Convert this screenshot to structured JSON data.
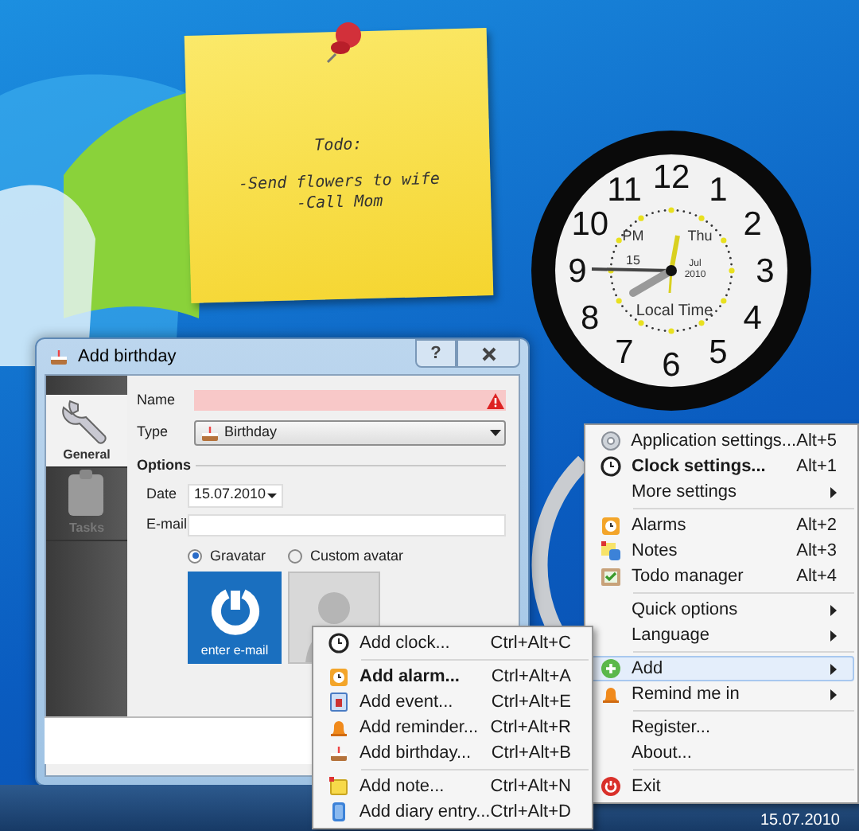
{
  "sticky_note": {
    "lines": [
      "Todo:",
      "-Send flowers to wife",
      "-Call Mom"
    ]
  },
  "clock": {
    "numerals": [
      "12",
      "11",
      "1",
      "10",
      "2",
      "9",
      "3",
      "8",
      "4",
      "7",
      "5",
      "6"
    ],
    "ampm": "PM",
    "weekday": "Thu",
    "day": "15",
    "month": "Jul",
    "year": "2010",
    "caption": "Local Time"
  },
  "dialog": {
    "title": "Add birthday",
    "help_button": "?",
    "sidebar": [
      {
        "label": "General",
        "selected": true
      },
      {
        "label": "Tasks",
        "selected": false
      }
    ],
    "name": {
      "label": "Name",
      "invalid": true
    },
    "type": {
      "label": "Type",
      "value": "Birthday"
    },
    "options_heading": "Options",
    "date": {
      "label": "Date",
      "value": "15.07.2010"
    },
    "email": {
      "label": "E-mail"
    },
    "avatar_options": [
      {
        "label": "Gravatar",
        "selected": true
      },
      {
        "label": "Custom avatar",
        "selected": false
      }
    ],
    "gravatar_caption": "enter e-mail"
  },
  "main_menu": [
    {
      "kind": "item",
      "label": "Application settings...",
      "shortcut": "Alt+5",
      "bold": false,
      "submenu": false,
      "selected": false
    },
    {
      "kind": "item",
      "label": "Clock settings...",
      "shortcut": "Alt+1",
      "bold": true,
      "submenu": false,
      "selected": false
    },
    {
      "kind": "item",
      "label": "More settings",
      "bold": false,
      "submenu": true,
      "selected": false
    },
    {
      "kind": "separator"
    },
    {
      "kind": "item",
      "label": "Alarms",
      "shortcut": "Alt+2",
      "bold": false,
      "submenu": false,
      "selected": false
    },
    {
      "kind": "item",
      "label": "Notes",
      "shortcut": "Alt+3",
      "bold": false,
      "submenu": false,
      "selected": false
    },
    {
      "kind": "item",
      "label": "Todo manager",
      "shortcut": "Alt+4",
      "bold": false,
      "submenu": false,
      "selected": false
    },
    {
      "kind": "separator"
    },
    {
      "kind": "item",
      "label": "Quick options",
      "bold": false,
      "submenu": true,
      "selected": false
    },
    {
      "kind": "item",
      "label": "Language",
      "bold": false,
      "submenu": true,
      "selected": false
    },
    {
      "kind": "separator"
    },
    {
      "kind": "item",
      "label": "Add",
      "bold": false,
      "submenu": true,
      "selected": true
    },
    {
      "kind": "item",
      "label": "Remind me in",
      "bold": false,
      "submenu": true,
      "selected": false
    },
    {
      "kind": "separator"
    },
    {
      "kind": "item",
      "label": "Register...",
      "bold": false,
      "submenu": false,
      "selected": false
    },
    {
      "kind": "item",
      "label": "About...",
      "bold": false,
      "submenu": false,
      "selected": false
    },
    {
      "kind": "separator"
    },
    {
      "kind": "item",
      "label": "Exit",
      "bold": false,
      "submenu": false,
      "selected": false
    }
  ],
  "add_submenu": [
    {
      "kind": "item",
      "label": "Add clock...",
      "shortcut": "Ctrl+Alt+C",
      "bold": false,
      "selected": false
    },
    {
      "kind": "separator"
    },
    {
      "kind": "item",
      "label": "Add alarm...",
      "shortcut": "Ctrl+Alt+A",
      "bold": true,
      "selected": false
    },
    {
      "kind": "item",
      "label": "Add event...",
      "shortcut": "Ctrl+Alt+E",
      "bold": false,
      "selected": false
    },
    {
      "kind": "item",
      "label": "Add reminder...",
      "shortcut": "Ctrl+Alt+R",
      "bold": false,
      "selected": false
    },
    {
      "kind": "item",
      "label": "Add birthday...",
      "shortcut": "Ctrl+Alt+B",
      "bold": false,
      "selected": false
    },
    {
      "kind": "separator"
    },
    {
      "kind": "item",
      "label": "Add note...",
      "shortcut": "Ctrl+Alt+N",
      "bold": false,
      "selected": false
    },
    {
      "kind": "item",
      "label": "Add diary entry...",
      "shortcut": "Ctrl+Alt+D",
      "bold": false,
      "selected": false
    }
  ],
  "taskbar": {
    "date": "15.07.2010"
  }
}
